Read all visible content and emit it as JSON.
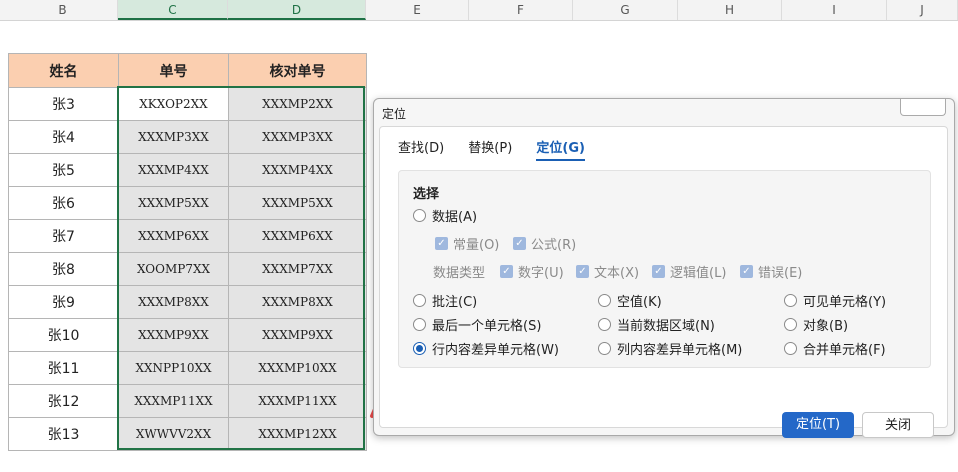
{
  "sheet": {
    "column_letters": [
      "B",
      "C",
      "D",
      "E",
      "F",
      "G",
      "H",
      "I",
      "J"
    ],
    "headers": [
      "姓名",
      "单号",
      "核对单号"
    ],
    "rows": [
      [
        "张3",
        "XKXOP2XX",
        "XXXMP2XX"
      ],
      [
        "张4",
        "XXXMP3XX",
        "XXXMP3XX"
      ],
      [
        "张5",
        "XXXMP4XX",
        "XXXMP4XX"
      ],
      [
        "张6",
        "XXXMP5XX",
        "XXXMP5XX"
      ],
      [
        "张7",
        "XXXMP6XX",
        "XXXMP6XX"
      ],
      [
        "张8",
        "XOOMP7XX",
        "XXXMP7XX"
      ],
      [
        "张9",
        "XXXMP8XX",
        "XXXMP8XX"
      ],
      [
        "张10",
        "XXXMP9XX",
        "XXXMP9XX"
      ],
      [
        "张11",
        "XXNPP10XX",
        "XXXMP10XX"
      ],
      [
        "张12",
        "XXXMP11XX",
        "XXXMP11XX"
      ],
      [
        "张13",
        "XWWVV2XX",
        "XXXMP12XX"
      ]
    ],
    "header_color": "#fbcfb0",
    "selection_color": "#217346"
  },
  "dialog": {
    "title": "定位",
    "tabs": [
      "查找(D)",
      "替换(P)",
      "定位(G)"
    ],
    "active_tab": "定位(G)",
    "group_title": "选择",
    "opt_data": "数据(A)",
    "sub_checks": [
      "常量(O)",
      "公式(R)"
    ],
    "data_type_label": "数据类型",
    "type_checks": [
      "数字(U)",
      "文本(X)",
      "逻辑值(L)",
      "错误(E)"
    ],
    "options": [
      "批注(C)",
      "空值(K)",
      "可见单元格(Y)",
      "最后一个单元格(S)",
      "当前数据区域(N)",
      "对象(B)",
      "行内容差异单元格(W)",
      "列内容差异单元格(M)",
      "合并单元格(F)"
    ],
    "selected_option": "行内容差异单元格(W)",
    "btn_locate": "定位(T)",
    "btn_close": "关闭",
    "accent": "#2468c8"
  },
  "arrow_color": "#e74c4c"
}
